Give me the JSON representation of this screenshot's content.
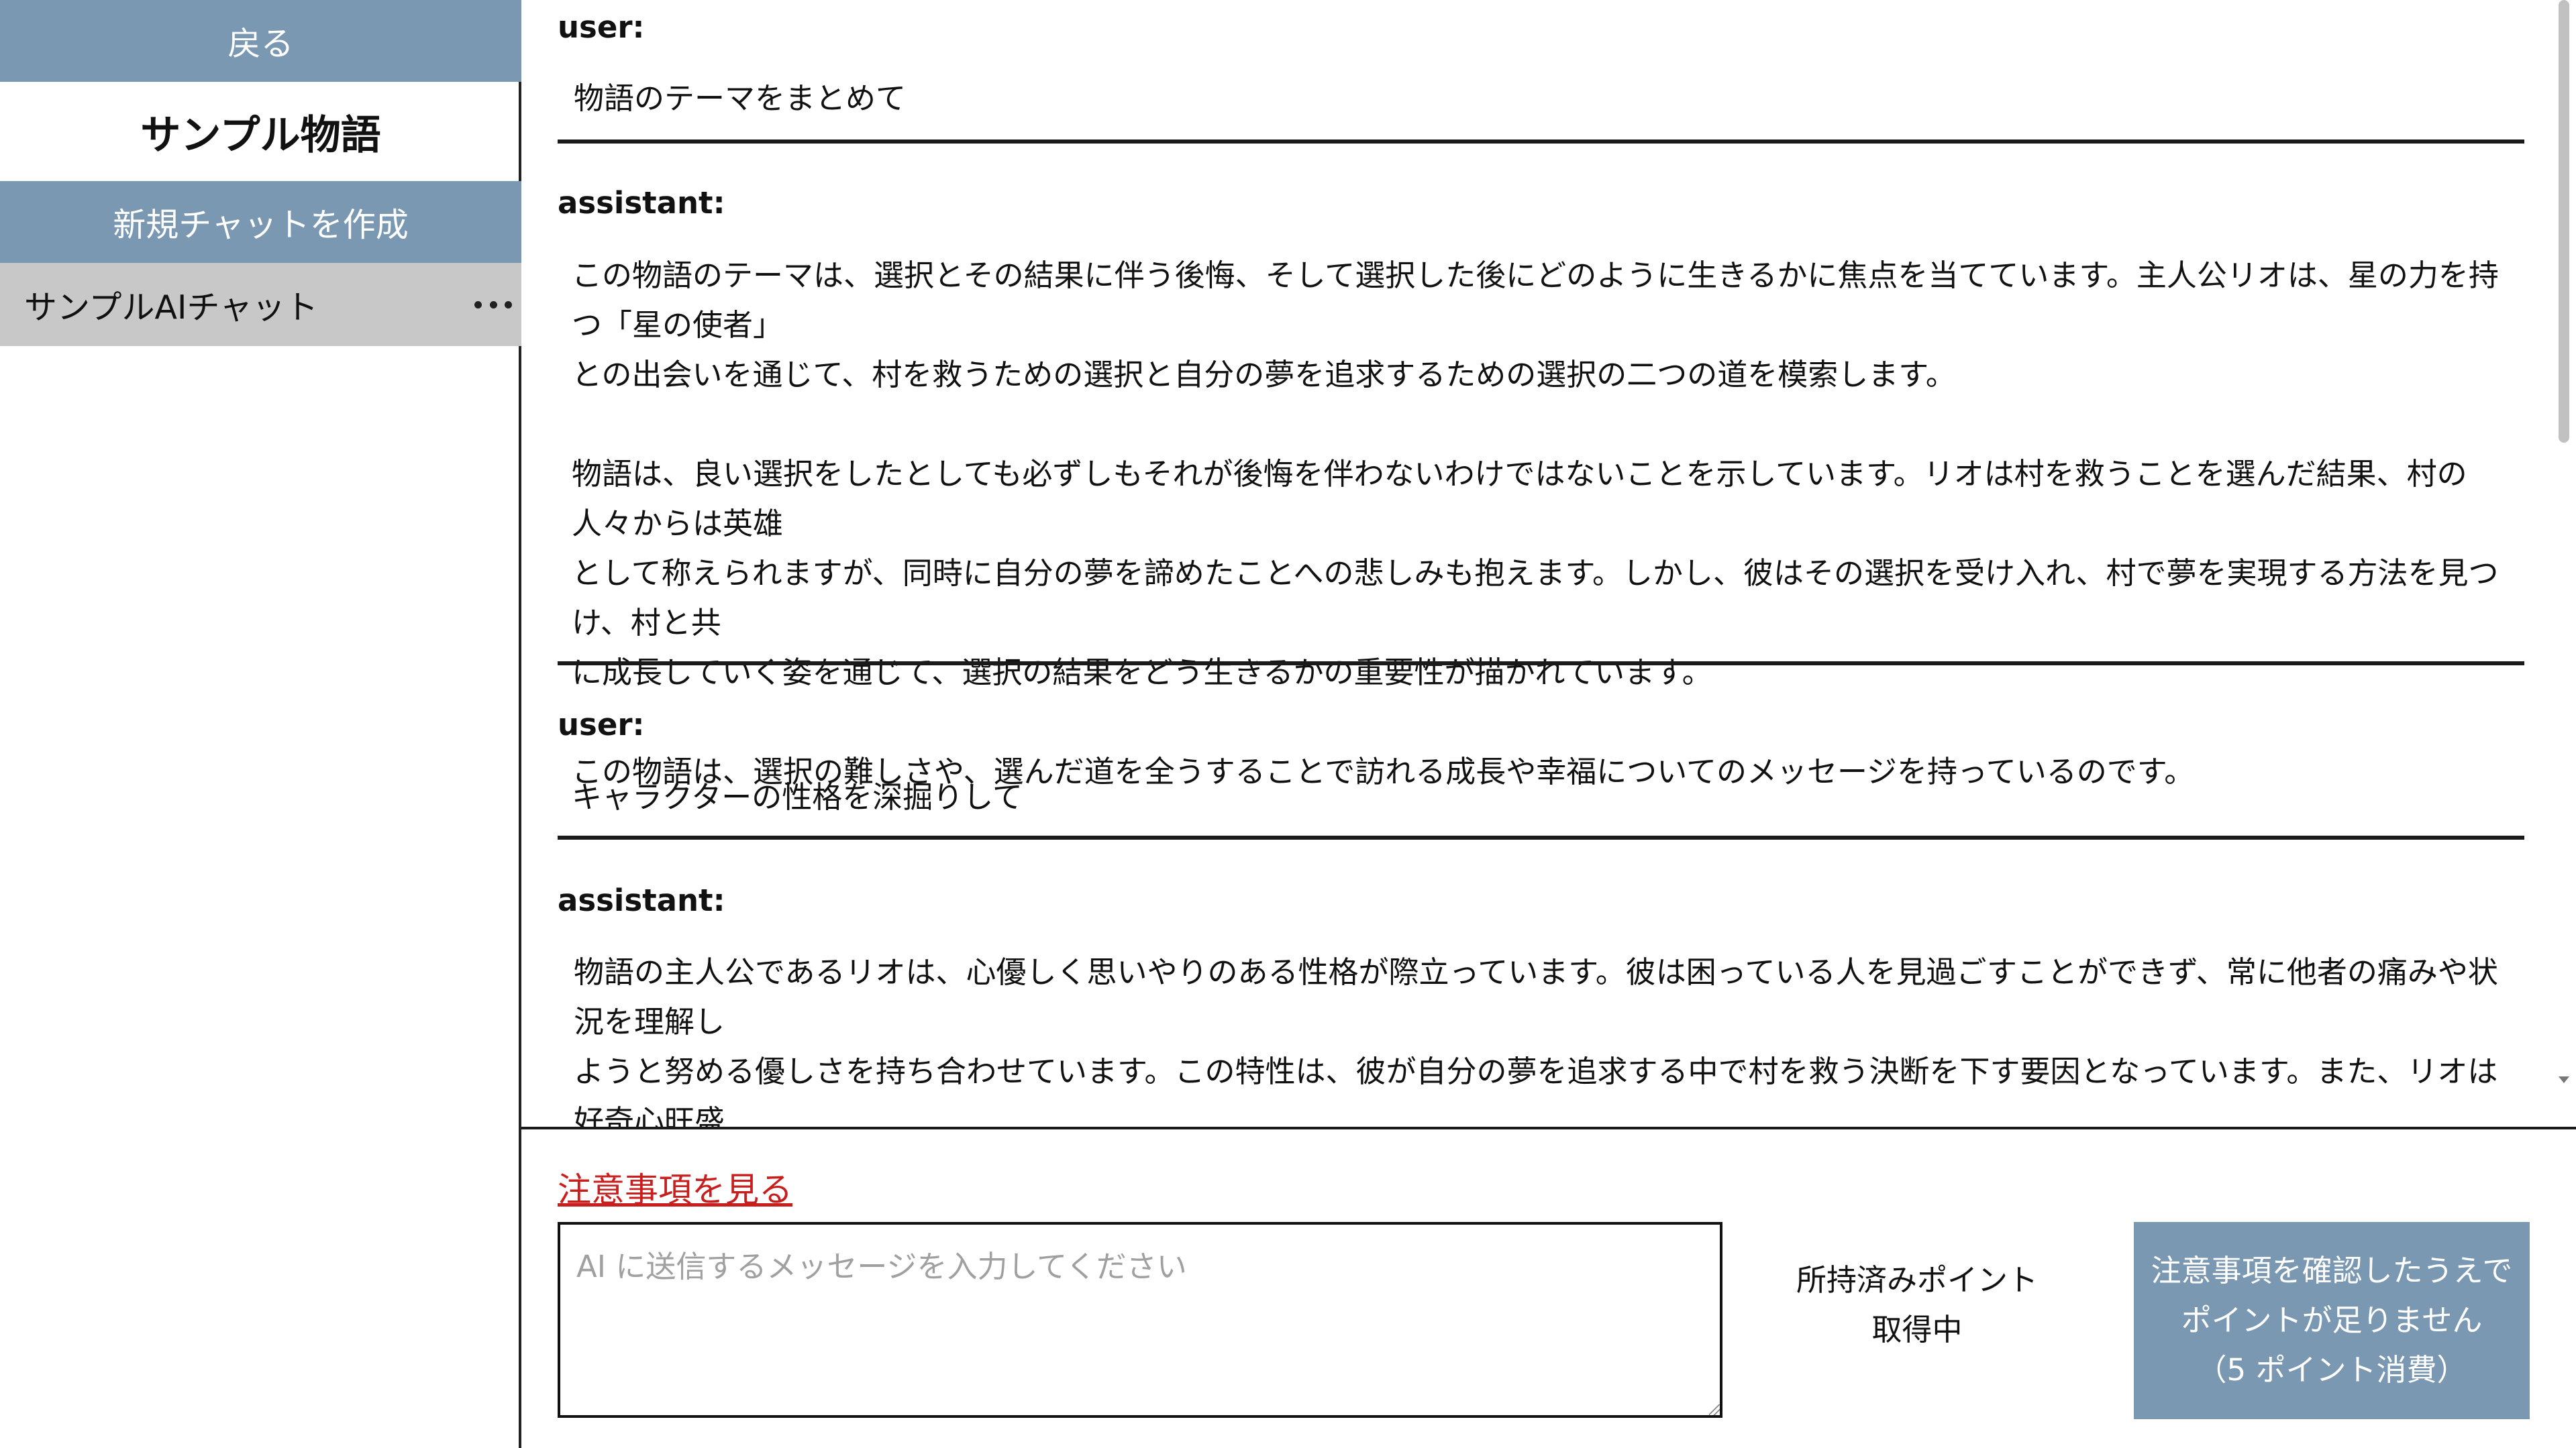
{
  "sidebar": {
    "back_label": "戻る",
    "story_title": "サンプル物語",
    "new_chat_label": "新規チャットを作成",
    "chats": [
      {
        "label": "サンプルAIチャット",
        "menu_icon": "more-horizontal-icon"
      }
    ]
  },
  "messages": [
    {
      "role": "user:",
      "text": "物語のテーマをまとめて"
    },
    {
      "role": "assistant:",
      "text": "この物語のテーマは、選択とその結果に伴う後悔、そして選択した後にどのように生きるかに焦点を当てています。主人公リオは、星の力を持つ「星の使者」\nとの出会いを通じて、村を救うための選択と自分の夢を追求するための選択の二つの道を模索します。\n\n物語は、良い選択をしたとしても必ずしもそれが後悔を伴わないわけではないことを示しています。リオは村を救うことを選んだ結果、村の人々からは英雄\nとして称えられますが、同時に自分の夢を諦めたことへの悲しみも抱えます。しかし、彼はその選択を受け入れ、村で夢を実現する方法を見つけ、村と共\nに成長していく姿を通じて、選択の結果をどう生きるかの重要性が描かれています。\n\nこの物語は、選択の難しさや、選んだ道を全うすることで訪れる成長や幸福についてのメッセージを持っているのです。"
    },
    {
      "role": "user:",
      "text": "キャラクターの性格を深掘りして"
    },
    {
      "role": "assistant:",
      "text": "物語の主人公であるリオは、心優しく思いやりのある性格が際立っています。彼は困っている人を見過ごすことができず、常に他者の痛みや状況を理解し\nようと努める優しさを持ち合わせています。この特性は、彼が自分の夢を追求する中で村を救う決断を下す要因となっています。また、リオは好奇心旺盛\nで、未知の世界に対する憧れを抱いていることから、冒険や新たな挑戦にも心を弾ませています。"
    }
  ],
  "composer": {
    "notice_link": "注意事項を見る",
    "input_placeholder": "AI に送信するメッセージを入力してください",
    "input_value": "",
    "points_label": "所持済みポイント",
    "points_value": "取得中",
    "send_line1": "注意事項を確認したうえで",
    "send_line2": "ポイントが足りません",
    "send_line3": "（5 ポイント消費）"
  },
  "colors": {
    "accent_button": "#7a98b2",
    "selected_chat": "#c8c8c8",
    "notice_link": "#c81e1e"
  }
}
